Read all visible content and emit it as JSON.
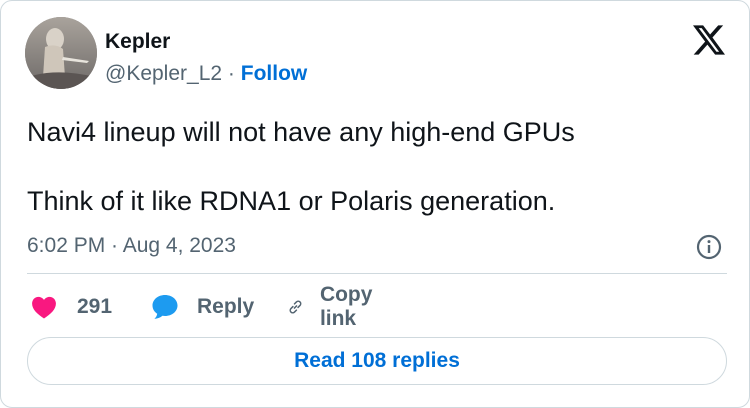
{
  "author": {
    "name": "Kepler",
    "handle": "@Kepler_L2",
    "separator": "·",
    "follow_label": "Follow",
    "avatar_icon": "avatar-image"
  },
  "brand": {
    "logo_icon": "x-logo-icon"
  },
  "tweet": {
    "line1": "Navi4 lineup will not have any high-end GPUs",
    "line2": "Think of it like RDNA1 or Polaris generation.",
    "timestamp": "6:02 PM · Aug 4, 2023"
  },
  "actions": {
    "like_count": "291",
    "reply_label": "Reply",
    "copy_label": "Copy link"
  },
  "read_replies_label": "Read 108 replies",
  "colors": {
    "accent": "#006fd6",
    "like": "#f91880",
    "muted": "#536471",
    "border": "#cfd9de"
  }
}
